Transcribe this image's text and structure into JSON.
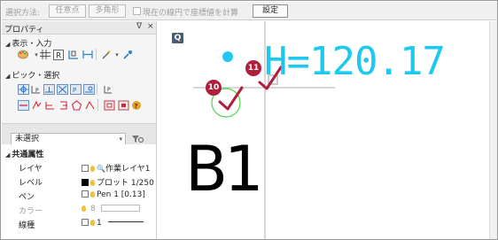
{
  "toolbar": {
    "method_label": "選択方法:",
    "btn_any_point": "任意点",
    "btn_polygon": "多角形",
    "checkbox_label": "現在の線円で座標値を計算",
    "btn_settings": "設定"
  },
  "panel": {
    "title": "プロパティ",
    "close_glyph": "×",
    "pin_glyph": "ᐁ",
    "section_display": "表示・入力",
    "section_pick": "ピック・選択",
    "selection_combo": "未選択",
    "common_attrs": "共通属性",
    "props": [
      {
        "key": "レイヤ",
        "value": "作業レイヤ1"
      },
      {
        "key": "レベル",
        "value": "プロット 1/250"
      },
      {
        "key": "ペン",
        "value": "Pen 1 [0.13]"
      },
      {
        "key": "カラー",
        "value": "8"
      },
      {
        "key": "線種",
        "value": "1"
      }
    ]
  },
  "canvas": {
    "q_badge": "Q",
    "height_text": "H=120.17",
    "block_text": "B1",
    "badge_10": "10",
    "badge_11": "11"
  },
  "colors": {
    "accent_cyan": "#1ec8ee",
    "badge_red": "#b01e3c",
    "circle_green": "#4cd64c"
  }
}
